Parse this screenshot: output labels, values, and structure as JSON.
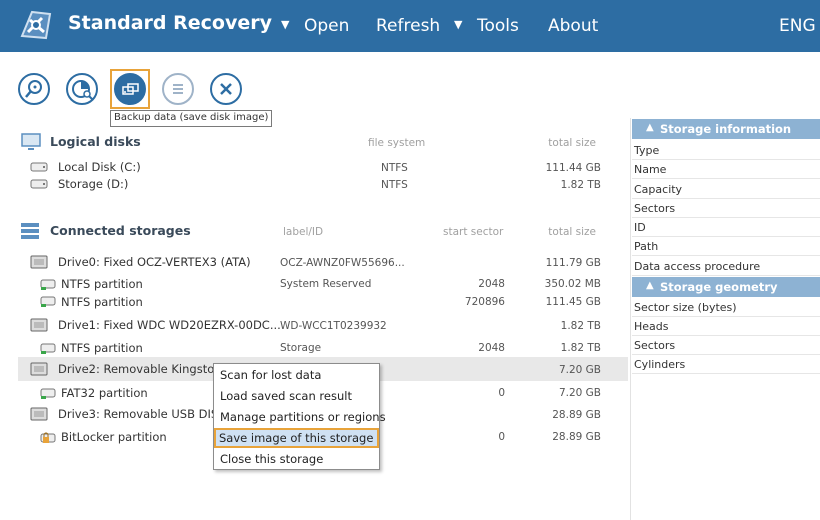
{
  "header": {
    "title": "Standard Recovery",
    "menu": [
      "Open",
      "Refresh",
      "Tools",
      "About"
    ],
    "language": "ENG"
  },
  "toolbar": {
    "buttons": [
      {
        "icon": "search-disk-icon"
      },
      {
        "icon": "scan-icon"
      },
      {
        "icon": "backup-icon"
      },
      {
        "icon": "list-icon"
      },
      {
        "icon": "close-icon"
      }
    ],
    "tooltip": "Backup data (save disk image)"
  },
  "logical": {
    "title": "Logical disks",
    "col_fs": "file system",
    "col_size": "total size",
    "rows": [
      {
        "name": "Local Disk (C:)",
        "fs": "NTFS",
        "size": "111.44 GB"
      },
      {
        "name": "Storage (D:)",
        "fs": "NTFS",
        "size": "1.82 TB"
      }
    ]
  },
  "storages": {
    "title": "Connected storages",
    "col_label": "label/ID",
    "col_start": "start sector",
    "col_size": "total size",
    "rows": [
      {
        "name": "Drive0: Fixed OCZ-VERTEX3 (ATA)",
        "label": "OCZ-AWNZ0FW55696...",
        "start": "",
        "size": "111.79 GB"
      },
      {
        "name": "NTFS partition",
        "label": "System Reserved",
        "start": "2048",
        "size": "350.02 MB"
      },
      {
        "name": "NTFS partition",
        "label": "",
        "start": "720896",
        "size": "111.45 GB"
      },
      {
        "name": "Drive1: Fixed WDC WD20EZRX-00DC...",
        "label": "WD-WCC1T0239932",
        "start": "",
        "size": "1.82 TB"
      },
      {
        "name": "NTFS partition",
        "label": "Storage",
        "start": "2048",
        "size": "1.82 TB"
      },
      {
        "name": "Drive2: Removable Kingston",
        "label": "",
        "start": "",
        "size": "7.20 GB"
      },
      {
        "name": "FAT32 partition",
        "label": "",
        "start": "0",
        "size": "7.20 GB"
      },
      {
        "name": "Drive3: Removable USB DISK",
        "label": "",
        "start": "",
        "size": "28.89 GB"
      },
      {
        "name": "BitLocker partition",
        "label": "",
        "start": "0",
        "size": "28.89 GB"
      }
    ]
  },
  "context_menu": {
    "items": [
      "Scan for lost data",
      "Load saved scan result",
      "Manage partitions or regions",
      "Save image of this storage",
      "Close this storage"
    ],
    "highlighted_index": 3
  },
  "info_panel": {
    "storage_information": {
      "title": "Storage information",
      "fields": [
        "Type",
        "Name",
        "Capacity",
        "Sectors",
        "ID",
        "Path",
        "Data access procedure"
      ]
    },
    "storage_geometry": {
      "title": "Storage geometry",
      "fields": [
        "Sector size (bytes)",
        "Heads",
        "Sectors",
        "Cylinders"
      ]
    }
  },
  "colors": {
    "header_bg": "#2d6da3",
    "panel_header": "#8db2d3",
    "highlight": "#e8a33a",
    "selected_row": "#e8e8e8"
  }
}
